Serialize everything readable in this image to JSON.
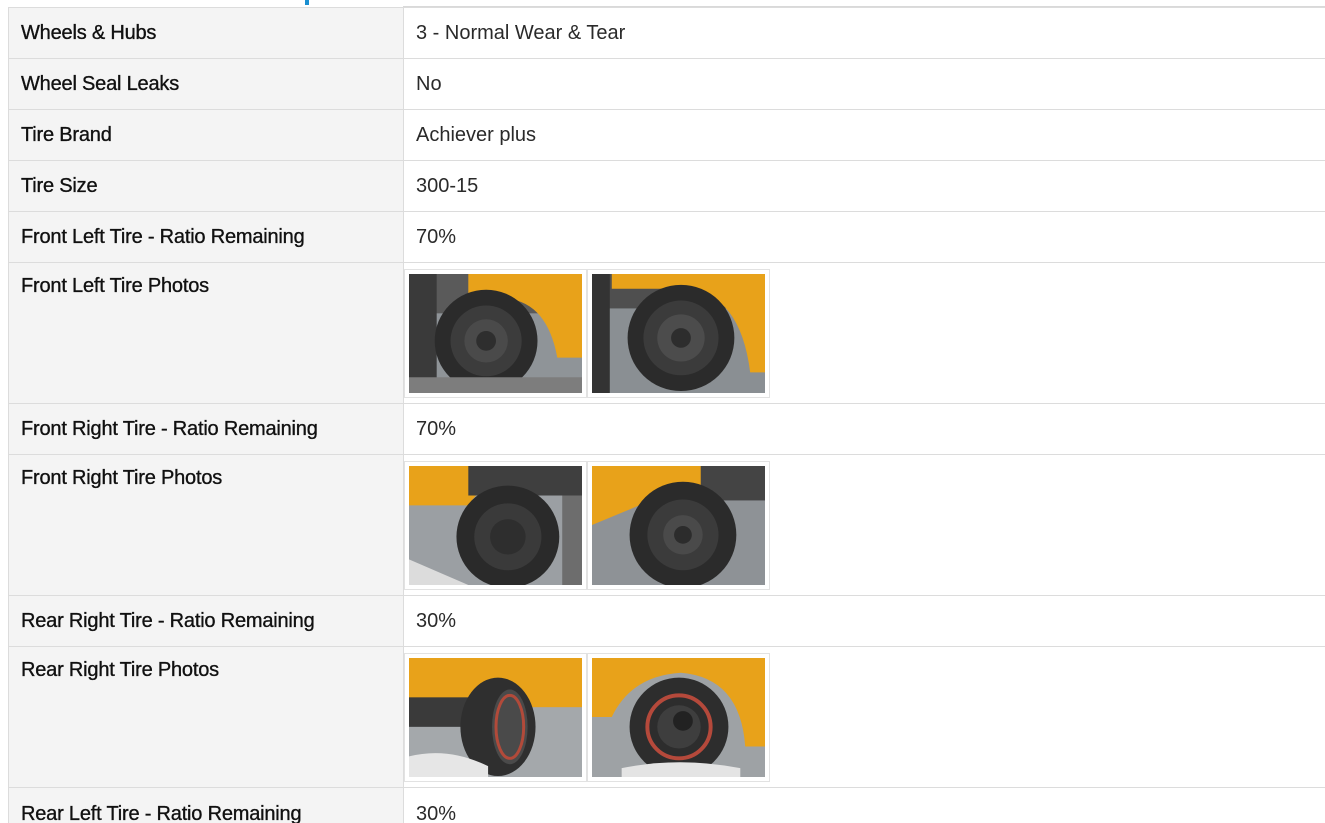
{
  "rows": [
    {
      "label": "Wheels & Hubs",
      "value": "3 - Normal Wear & Tear"
    },
    {
      "label": "Wheel Seal Leaks",
      "value": "No"
    },
    {
      "label": "Tire Brand",
      "value": "Achiever plus"
    },
    {
      "label": "Tire Size",
      "value": "300-15"
    },
    {
      "label": "Front Left Tire - Ratio Remaining",
      "value": "70%"
    },
    {
      "label": "Front Left Tire Photos",
      "photos": [
        "tire-photo",
        "tire-photo"
      ]
    },
    {
      "label": "Front Right Tire - Ratio Remaining",
      "value": "70%"
    },
    {
      "label": "Front Right Tire Photos",
      "photos": [
        "tire-photo",
        "tire-photo"
      ]
    },
    {
      "label": "Rear Right Tire - Ratio Remaining",
      "value": "30%"
    },
    {
      "label": "Rear Right Tire Photos",
      "photos": [
        "tire-photo",
        "tire-photo"
      ]
    },
    {
      "label": "Rear Left Tire - Ratio Remaining",
      "value": "30%"
    }
  ],
  "colors": {
    "accent": "#1a8fd1",
    "label_bg": "#f4f4f4",
    "border": "#dcdcdc",
    "forklift_yellow": "#e8a21a",
    "tire_black": "#2b2b2b",
    "ground": "#9a9a9a"
  }
}
